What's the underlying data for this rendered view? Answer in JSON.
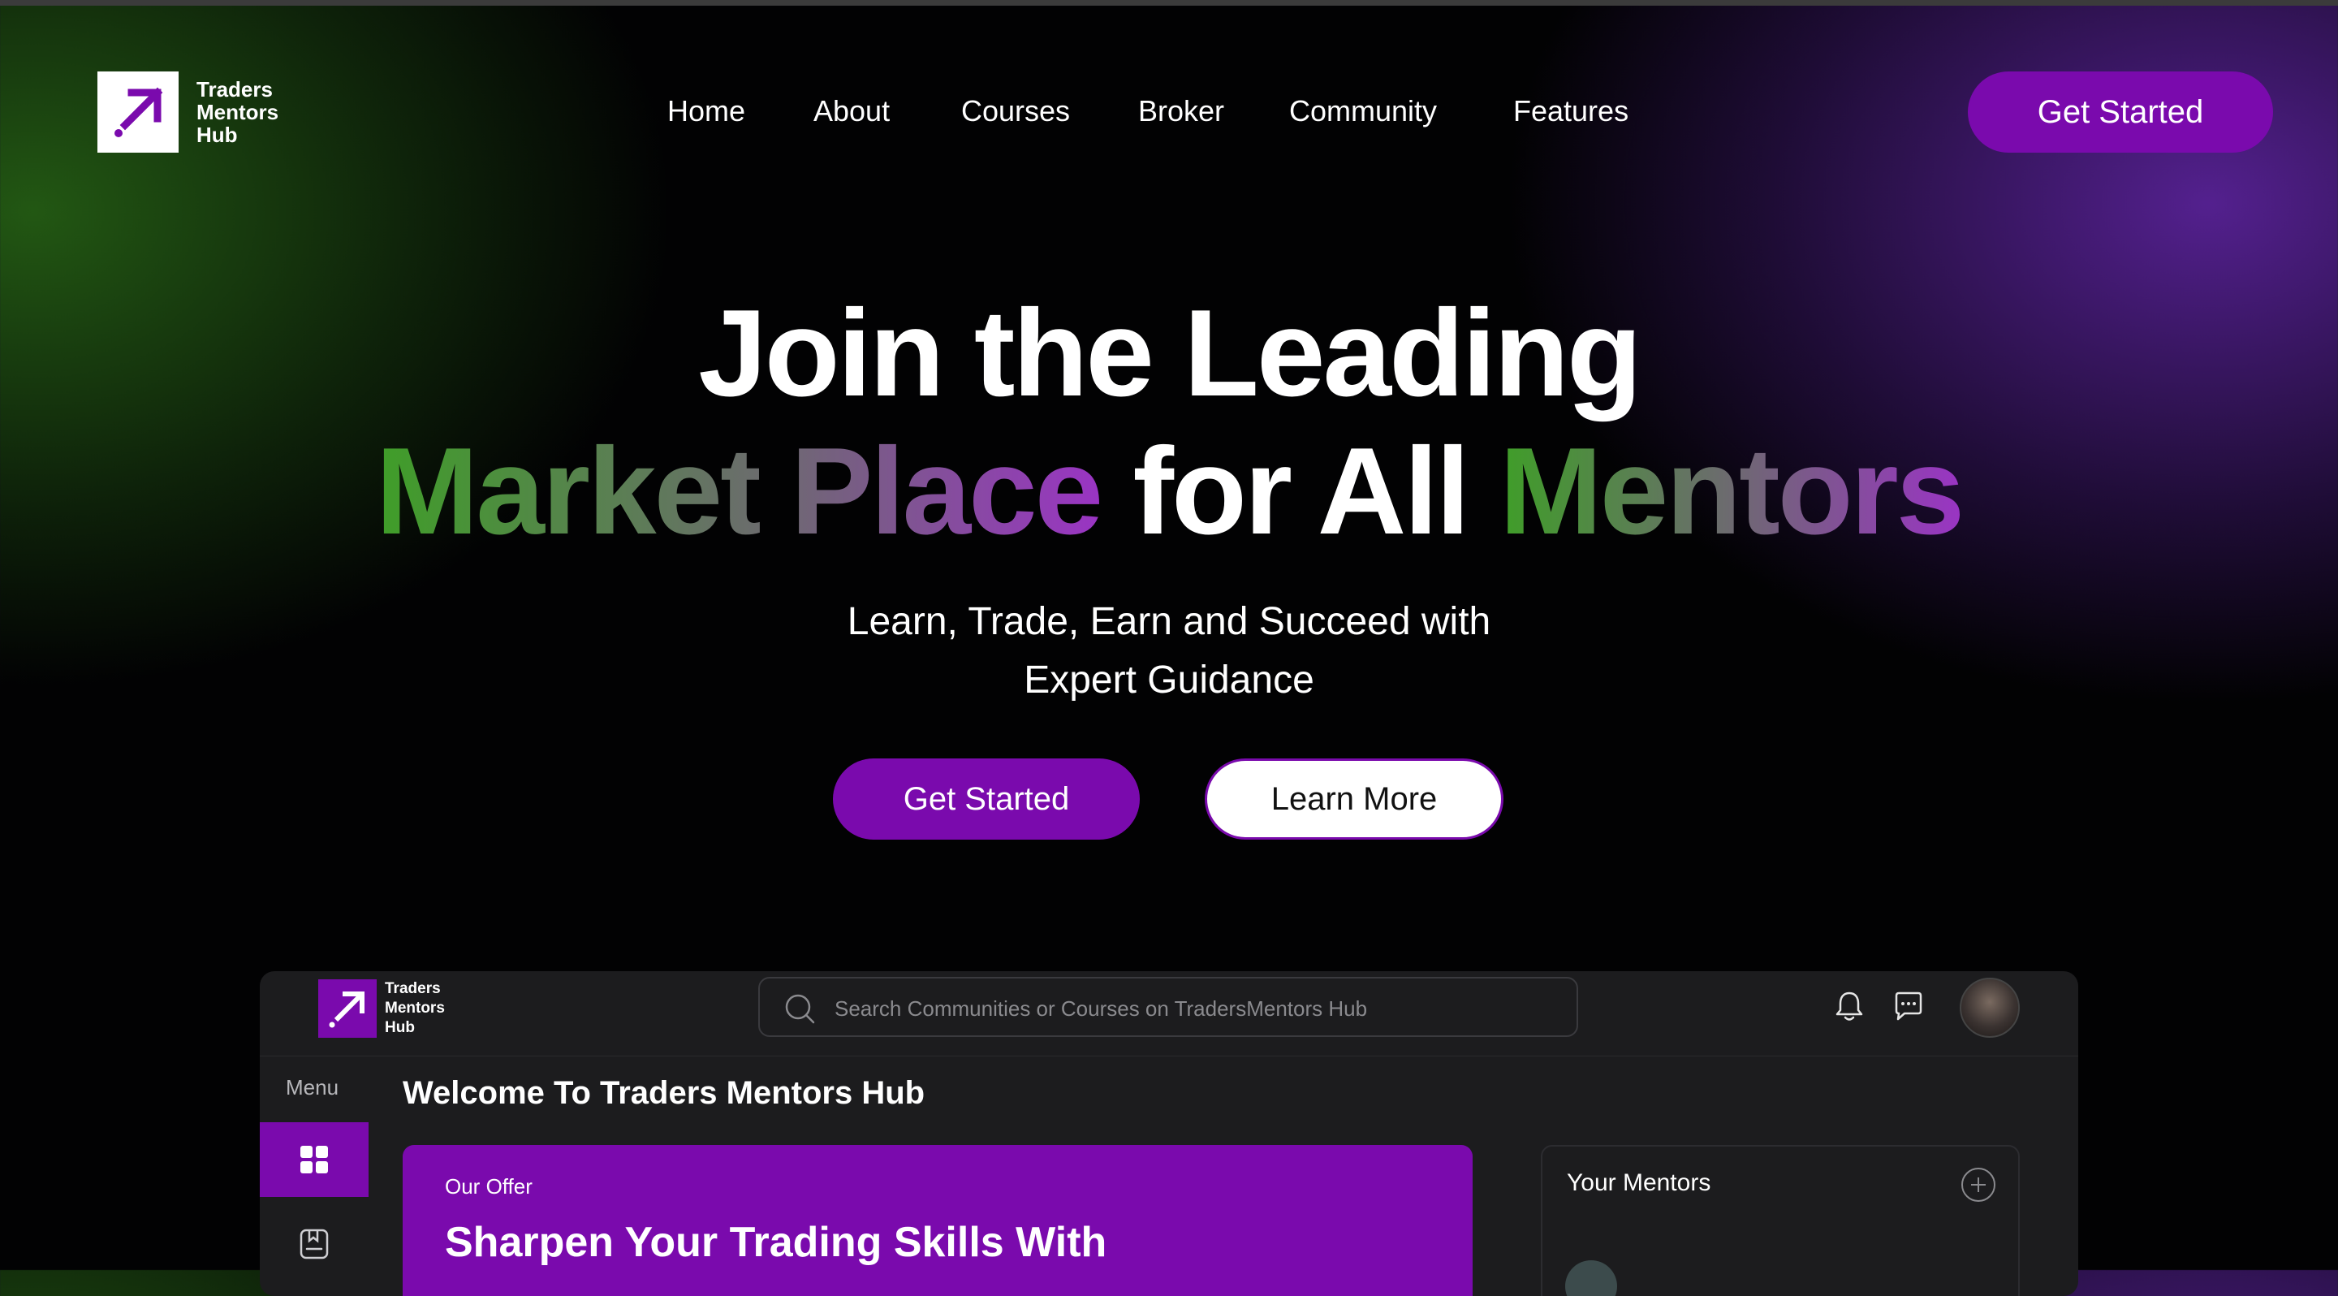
{
  "brand": {
    "line1": "Traders",
    "line2": "Mentors",
    "line3": "Hub"
  },
  "nav": {
    "items": [
      "Home",
      "About",
      "Courses",
      "Broker",
      "Community",
      "Features"
    ],
    "cta": "Get Started"
  },
  "hero": {
    "line1": "Join the Leading",
    "line2_part1": "Market Place",
    "line2_part2": "for All",
    "line2_part3": "Mentors",
    "subtitle_line1": "Learn, Trade, Earn and Succeed with",
    "subtitle_line2": "Expert Guidance",
    "primary_button": "Get Started",
    "secondary_button": "Learn More"
  },
  "app": {
    "logo": {
      "line1": "Traders",
      "line2": "Mentors",
      "line3": "Hub"
    },
    "search_placeholder": "Search Communities or Courses on TradersMentors Hub",
    "menu_label": "Menu",
    "welcome": "Welcome To Traders Mentors Hub",
    "offer": {
      "label": "Our Offer",
      "title": "Sharpen Your Trading Skills With"
    },
    "mentors_title": "Your Mentors"
  },
  "colors": {
    "accent": "#7a0aad",
    "green": "#3f9e28",
    "purple": "#9a34c4"
  }
}
